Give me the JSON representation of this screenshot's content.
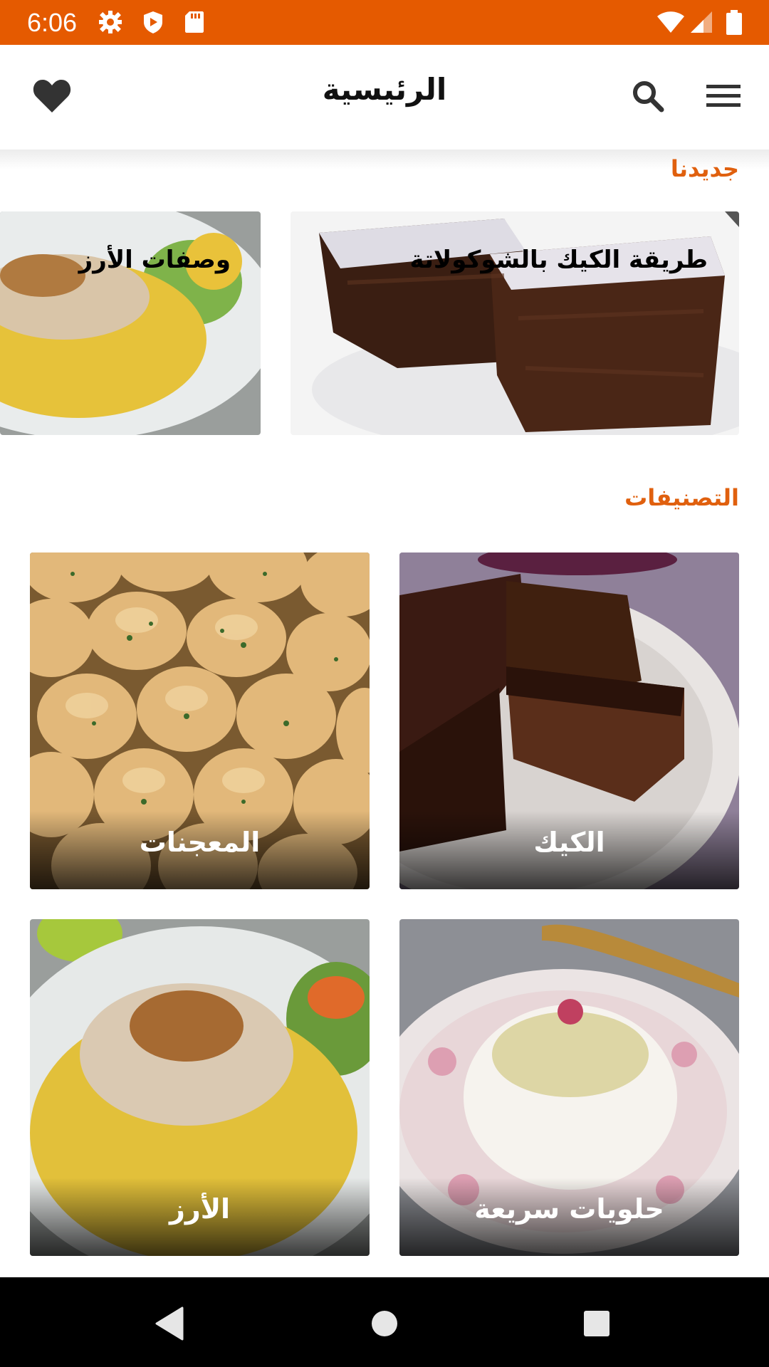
{
  "status_bar": {
    "time": "6:06",
    "icons": [
      "settings-icon",
      "shield-icon",
      "sd-card-icon",
      "wifi-icon",
      "signal-icon",
      "battery-icon"
    ],
    "color": "#e55a00"
  },
  "app_bar": {
    "title": "الرئيسية",
    "left_icon": "heart-icon",
    "right_icons": [
      "search-icon",
      "menu-icon"
    ]
  },
  "featured": {
    "section_title": "جديدنا",
    "items": [
      {
        "label": "طريقة الكيك بالشوكولاتة",
        "image": "chocolate-brownie-photo"
      },
      {
        "label": "وصفات الأرز",
        "image": "chicken-rice-photo"
      }
    ]
  },
  "categories": {
    "section_title": "التصنيفات",
    "items": [
      {
        "label": "الكيك",
        "image": "chocolate-cake-photo"
      },
      {
        "label": "المعجنات",
        "image": "garlic-bread-rolls-photo"
      },
      {
        "label": "حلويات سريعة",
        "image": "pudding-dessert-photo"
      },
      {
        "label": "الأرز",
        "image": "chicken-rice-photo"
      }
    ]
  },
  "nav_bar": {
    "buttons": [
      "back-icon",
      "home-icon",
      "recents-icon"
    ]
  },
  "accent_color": "#e0600e"
}
